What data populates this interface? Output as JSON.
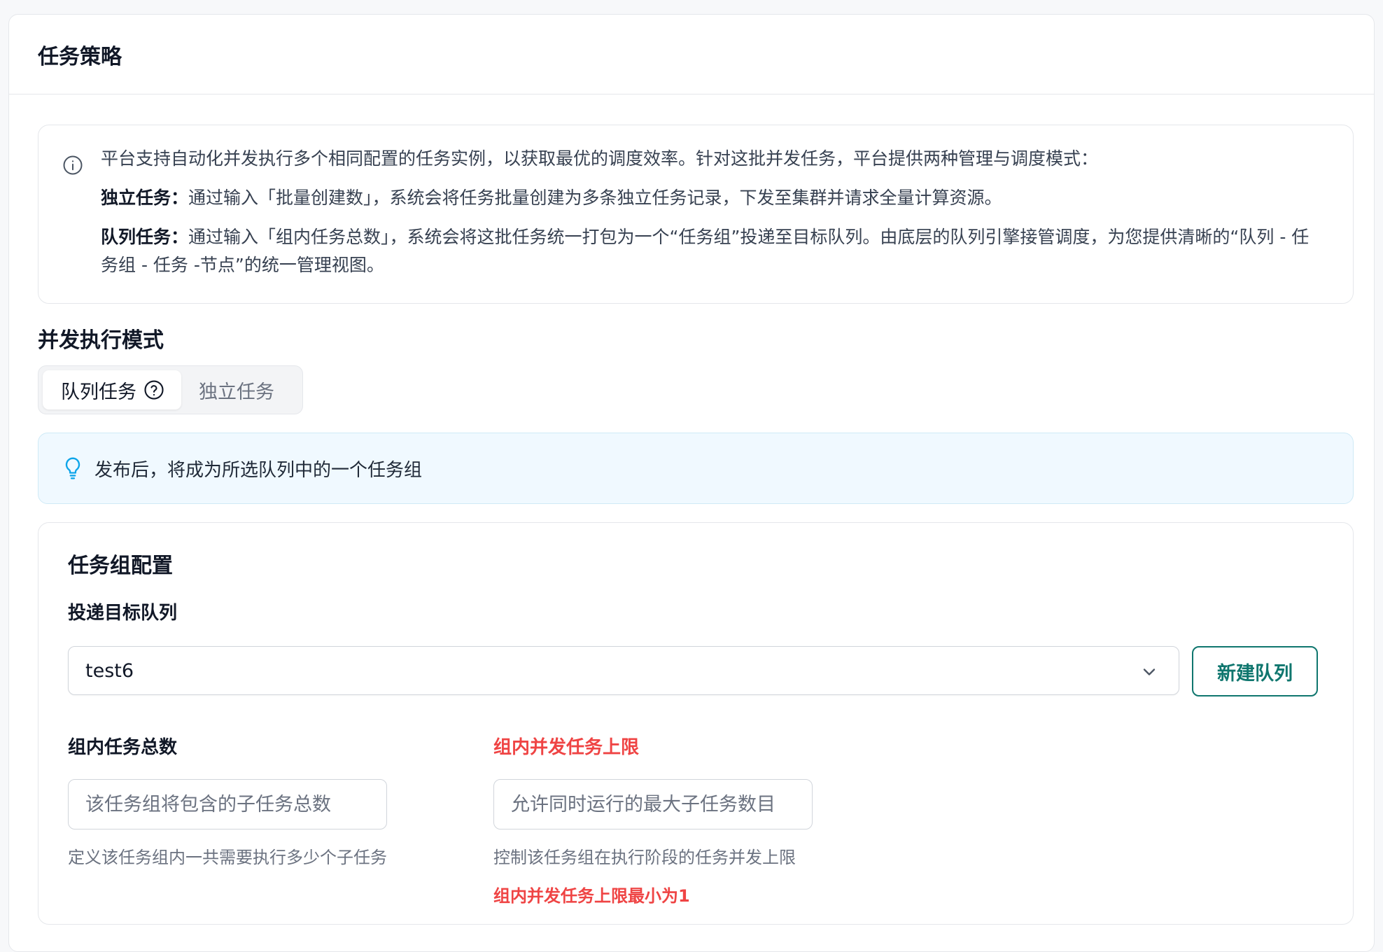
{
  "panel": {
    "title": "任务策略"
  },
  "intro": {
    "lead": "平台支持自动化并发执行多个相同配置的任务实例，以获取最优的调度效率。针对这批并发任务，平台提供两种管理与调度模式：",
    "independent_term": "独立任务：",
    "independent_desc": "通过输入「批量创建数」，系统会将任务批量创建为多条独立任务记录，下发至集群并请求全量计算资源。",
    "queue_term": "队列任务：",
    "queue_desc": "通过输入「组内任务总数」，系统会将这批任务统一打包为一个“任务组”投递至目标队列。由底层的队列引擎接管调度，为您提供清晰的“队列 - 任务组 - 任务 -节点”的统一管理视图。"
  },
  "mode": {
    "title": "并发执行模式",
    "options": [
      "队列任务",
      "独立任务"
    ],
    "selected": "队列任务"
  },
  "tip": {
    "text": "发布后，将成为所选队列中的一个任务组"
  },
  "group_config": {
    "title": "任务组配置",
    "target_queue": {
      "label": "投递目标队列",
      "value": "test6",
      "new_button": "新建队列"
    },
    "total_tasks": {
      "label": "组内任务总数",
      "placeholder": "该任务组将包含的子任务总数",
      "helper": "定义该任务组内一共需要执行多少个子任务"
    },
    "concurrency_limit": {
      "label": "组内并发任务上限",
      "placeholder": "允许同时运行的最大子任务数目",
      "helper": "控制该任务组在执行阶段的任务并发上限",
      "error": "组内并发任务上限最小为1"
    }
  },
  "colors": {
    "accent": "#0f766e",
    "error": "#ef4444",
    "tip_bg": "#f0f9ff",
    "info_icon": "#0ea5e9"
  }
}
